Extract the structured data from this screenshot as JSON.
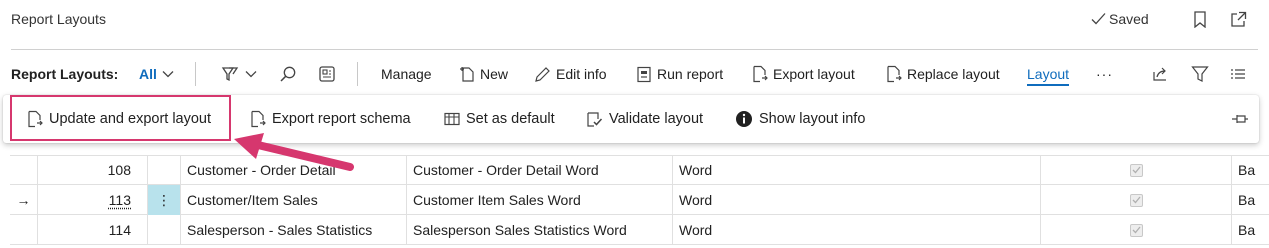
{
  "header": {
    "title": "Report Layouts",
    "saved_label": "Saved"
  },
  "action_bar": {
    "caption": "Report Layouts:",
    "filter_value": "All",
    "manage": "Manage",
    "new": "New",
    "edit_info": "Edit info",
    "run_report": "Run report",
    "export_layout": "Export layout",
    "replace_layout": "Replace layout",
    "layout_tab": "Layout",
    "more": "···"
  },
  "layout_menu": {
    "update_export": "Update and export layout",
    "export_schema": "Export report schema",
    "set_default": "Set as default",
    "validate": "Validate layout",
    "show_info": "Show layout info"
  },
  "colors": {
    "accent": "#0f6cbd",
    "highlight": "#d6376e",
    "selected_cell": "#b8e2ec"
  },
  "rows": [
    {
      "indicator": "",
      "id": "108",
      "name": "Customer - Order Detail",
      "layout": "Customer - Order Detail Word",
      "type": "Word",
      "extra": "Ba"
    },
    {
      "indicator": "→",
      "id": "113",
      "name": "Customer/Item Sales",
      "layout": "Customer Item Sales Word",
      "type": "Word",
      "extra": "Ba"
    },
    {
      "indicator": "",
      "id": "114",
      "name": "Salesperson - Sales Statistics",
      "layout": "Salesperson Sales Statistics Word",
      "type": "Word",
      "extra": "Ba"
    }
  ],
  "row_menu_glyph": "⋮"
}
